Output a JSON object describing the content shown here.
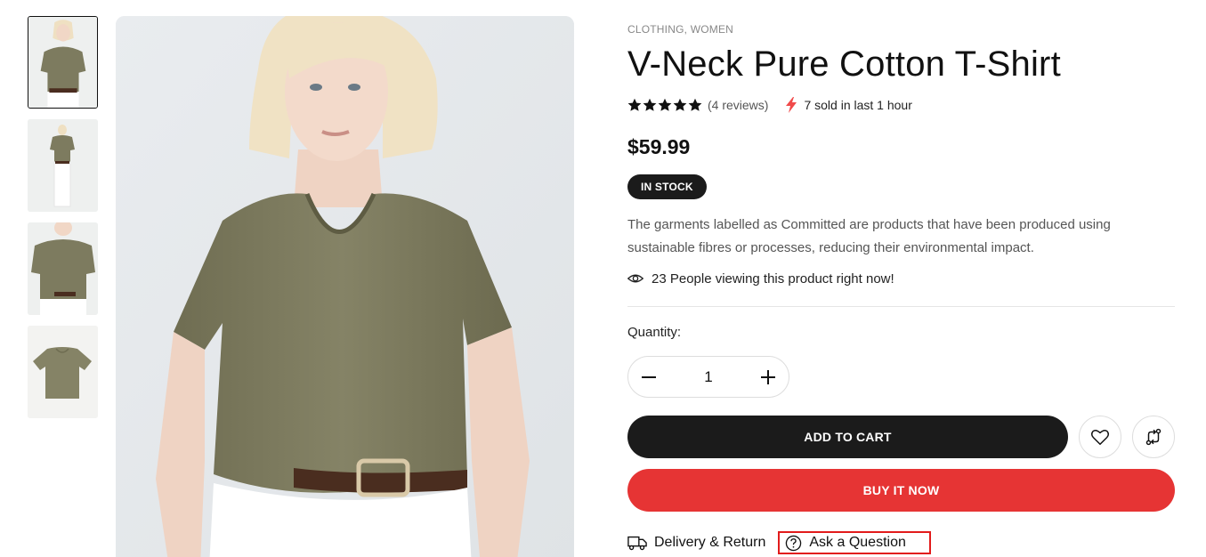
{
  "gallery": {
    "thumbnails": [
      {
        "alt": "front-view",
        "active": true
      },
      {
        "alt": "full-body-view",
        "active": false
      },
      {
        "alt": "close-view",
        "active": false
      },
      {
        "alt": "flat-lay-view",
        "active": false
      }
    ],
    "main_image": "model-wearing-olive-tshirt"
  },
  "product": {
    "categories": [
      "CLOTHING",
      "WOMEN"
    ],
    "category_separator": ", ",
    "title": "V-Neck Pure Cotton T-Shirt",
    "rating": 5,
    "reviews_text": "(4 reviews)",
    "sold_text": "7 sold in last 1 hour",
    "price": "$59.99",
    "stock_badge": "IN STOCK",
    "description": "The garments labelled as Committed are products that have been produced using sustainable fibres or processes, reducing their environmental impact.",
    "viewing_text": "23 People viewing this product right now!"
  },
  "purchase": {
    "quantity_label": "Quantity:",
    "quantity_value": "1",
    "add_to_cart_label": "ADD TO CART",
    "buy_now_label": "BUY IT NOW",
    "delivery_label": "Delivery & Return",
    "ask_label": "Ask a Question"
  },
  "colors": {
    "primary_dark": "#1b1b1b",
    "accent_red": "#e63434",
    "shirt_olive": "#7d7b5f",
    "lightning": "#f04a4a"
  },
  "icons": [
    "star-icon",
    "lightning-icon",
    "eye-icon",
    "minus-icon",
    "plus-icon",
    "heart-icon",
    "compare-icon",
    "truck-icon",
    "question-icon"
  ]
}
